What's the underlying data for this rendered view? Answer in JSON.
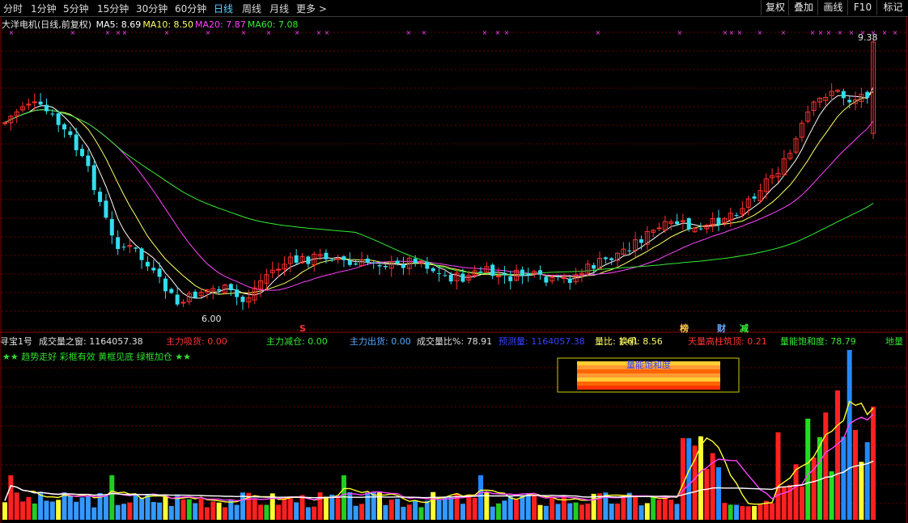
{
  "toolbar": {
    "periods": [
      {
        "label": "分时"
      },
      {
        "label": "1分钟"
      },
      {
        "label": "5分钟"
      },
      {
        "label": "15分钟"
      },
      {
        "label": "30分钟"
      },
      {
        "label": "60分钟"
      },
      {
        "label": "日线"
      },
      {
        "label": "周线"
      },
      {
        "label": "月线"
      },
      {
        "label": "更多 >"
      }
    ],
    "active": "日线",
    "right_buttons": [
      {
        "label": "复权"
      },
      {
        "label": "叠加"
      },
      {
        "label": "画线"
      },
      {
        "label": "F10"
      },
      {
        "label": "标记"
      }
    ]
  },
  "main": {
    "title": "大洋电机(日线,前复权)",
    "ma": [
      {
        "label": "MA5: 8.69",
        "color": "#ffffff"
      },
      {
        "label": "MA10: 8.50",
        "color": "#ffff66"
      },
      {
        "label": "MA20: 7.87",
        "color": "#ff44ff"
      },
      {
        "label": "MA60: 7.08",
        "color": "#33ee33"
      }
    ],
    "high_label": "9.38",
    "low_label": "6.00",
    "signal_mark": "S",
    "event_marks": [
      {
        "label": "榜",
        "color": "#ffcc44"
      },
      {
        "label": "财",
        "color": "#66aaff"
      },
      {
        "label": "减",
        "color": "#33ee33"
      }
    ]
  },
  "indicator": {
    "fields": [
      {
        "label": "寻宝1号",
        "color": "#e0e0e0"
      },
      {
        "label": "成交量之窗: 1164057.38",
        "color": "#e0e0e0"
      },
      {
        "label": "主力吸货: 0.00",
        "color": "#ff3333"
      },
      {
        "label": "主力减仓: 0.00",
        "color": "#33ee33"
      },
      {
        "label": "主力出货: 0.00",
        "color": "#55aaff"
      },
      {
        "label": "成交量比%: 78.91",
        "color": "#e0e0e0"
      },
      {
        "label": "预测量: 1164057.38",
        "color": "#3344ff"
      },
      {
        "label": "量比: 1.61",
        "color": "#ffff66"
      },
      {
        "label": "换手: 8.56",
        "color": "#ffff66"
      },
      {
        "label": "天量高柱筑顶: 0.21",
        "color": "#ff3333"
      },
      {
        "label": "量能饱和度: 78.79",
        "color": "#33ee33"
      }
    ],
    "trailing": "地量",
    "slogan": "★★ 趋势走好 彩框有效 黄框见底 绿框加仓 ★★",
    "saturation_label": "量能饱和度"
  },
  "colors": {
    "up": "#ff3030",
    "down": "#33ddee",
    "grid": "#6b0000",
    "ma5": "#ffffff",
    "ma10": "#ffff66",
    "ma20": "#ff44ff",
    "ma60": "#33ee33"
  }
}
